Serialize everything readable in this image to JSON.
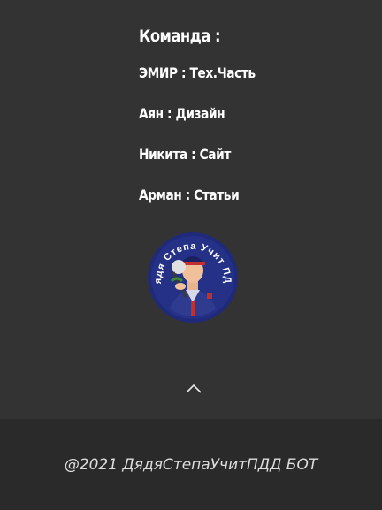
{
  "team": {
    "title": "Команда :",
    "members": [
      {
        "text": "ЭМИР : Тех.Часть"
      },
      {
        "text": "Аян : Дизайн"
      },
      {
        "text": "Никита : Сайт"
      },
      {
        "text": "Арман : Статьи"
      }
    ]
  },
  "logo": {
    "text": "Дядя Степа Учит ПДД",
    "icon": "uncle-styopa-logo"
  },
  "scroll_top": {
    "icon": "chevron-up-icon"
  },
  "footer": {
    "copyright": "@2021 ДядяСтепаУчитПДД БОТ"
  },
  "colors": {
    "background": "#333333",
    "footer_background": "#2a2a2a",
    "text": "#ffffff",
    "logo_ring": "#1f2a7a"
  }
}
